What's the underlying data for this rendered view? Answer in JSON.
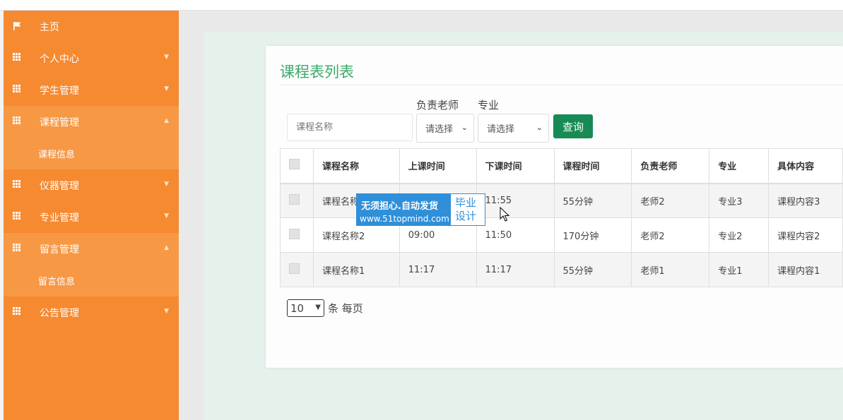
{
  "sidebar": {
    "home": "主页",
    "items": [
      {
        "label": "个人中心",
        "expanded": false
      },
      {
        "label": "学生管理",
        "expanded": false
      },
      {
        "label": "课程管理",
        "expanded": true,
        "sub": "课程信息"
      },
      {
        "label": "仪器管理",
        "expanded": false
      },
      {
        "label": "专业管理",
        "expanded": false
      },
      {
        "label": "留言管理",
        "expanded": true,
        "sub": "留言信息"
      },
      {
        "label": "公告管理",
        "expanded": false
      }
    ]
  },
  "panel": {
    "title": "课程表列表",
    "search_placeholder": "课程名称",
    "teacher_label": "负责老师",
    "major_label": "专业",
    "teacher_select": "请选择",
    "major_select": "请选择",
    "query_button": "查询"
  },
  "table": {
    "headers": [
      "课程名称",
      "上课时间",
      "下课时间",
      "课程时间",
      "负责老师",
      "专业",
      "具体内容"
    ],
    "rows": [
      [
        "课程名称3",
        "",
        "11:55",
        "55分钟",
        "老师2",
        "专业3",
        "课程内容3"
      ],
      [
        "课程名称2",
        "09:00",
        "11:50",
        "170分钟",
        "老师2",
        "专业2",
        "课程内容2"
      ],
      [
        "课程名称1",
        "11:17",
        "11:17",
        "55分钟",
        "老师1",
        "专业1",
        "课程内容1"
      ]
    ]
  },
  "pager": {
    "page_size": "10",
    "suffix": "条 每页"
  },
  "watermark": {
    "line1": "无须担心.自动发货",
    "url": "www.51topmind.com",
    "side1": "毕业",
    "side2": "设计"
  },
  "colors": {
    "sidebar": "#f58a31",
    "accent_green": "#3daa6a",
    "button_green": "#178a55",
    "watermark_blue": "#2f8fd8"
  }
}
